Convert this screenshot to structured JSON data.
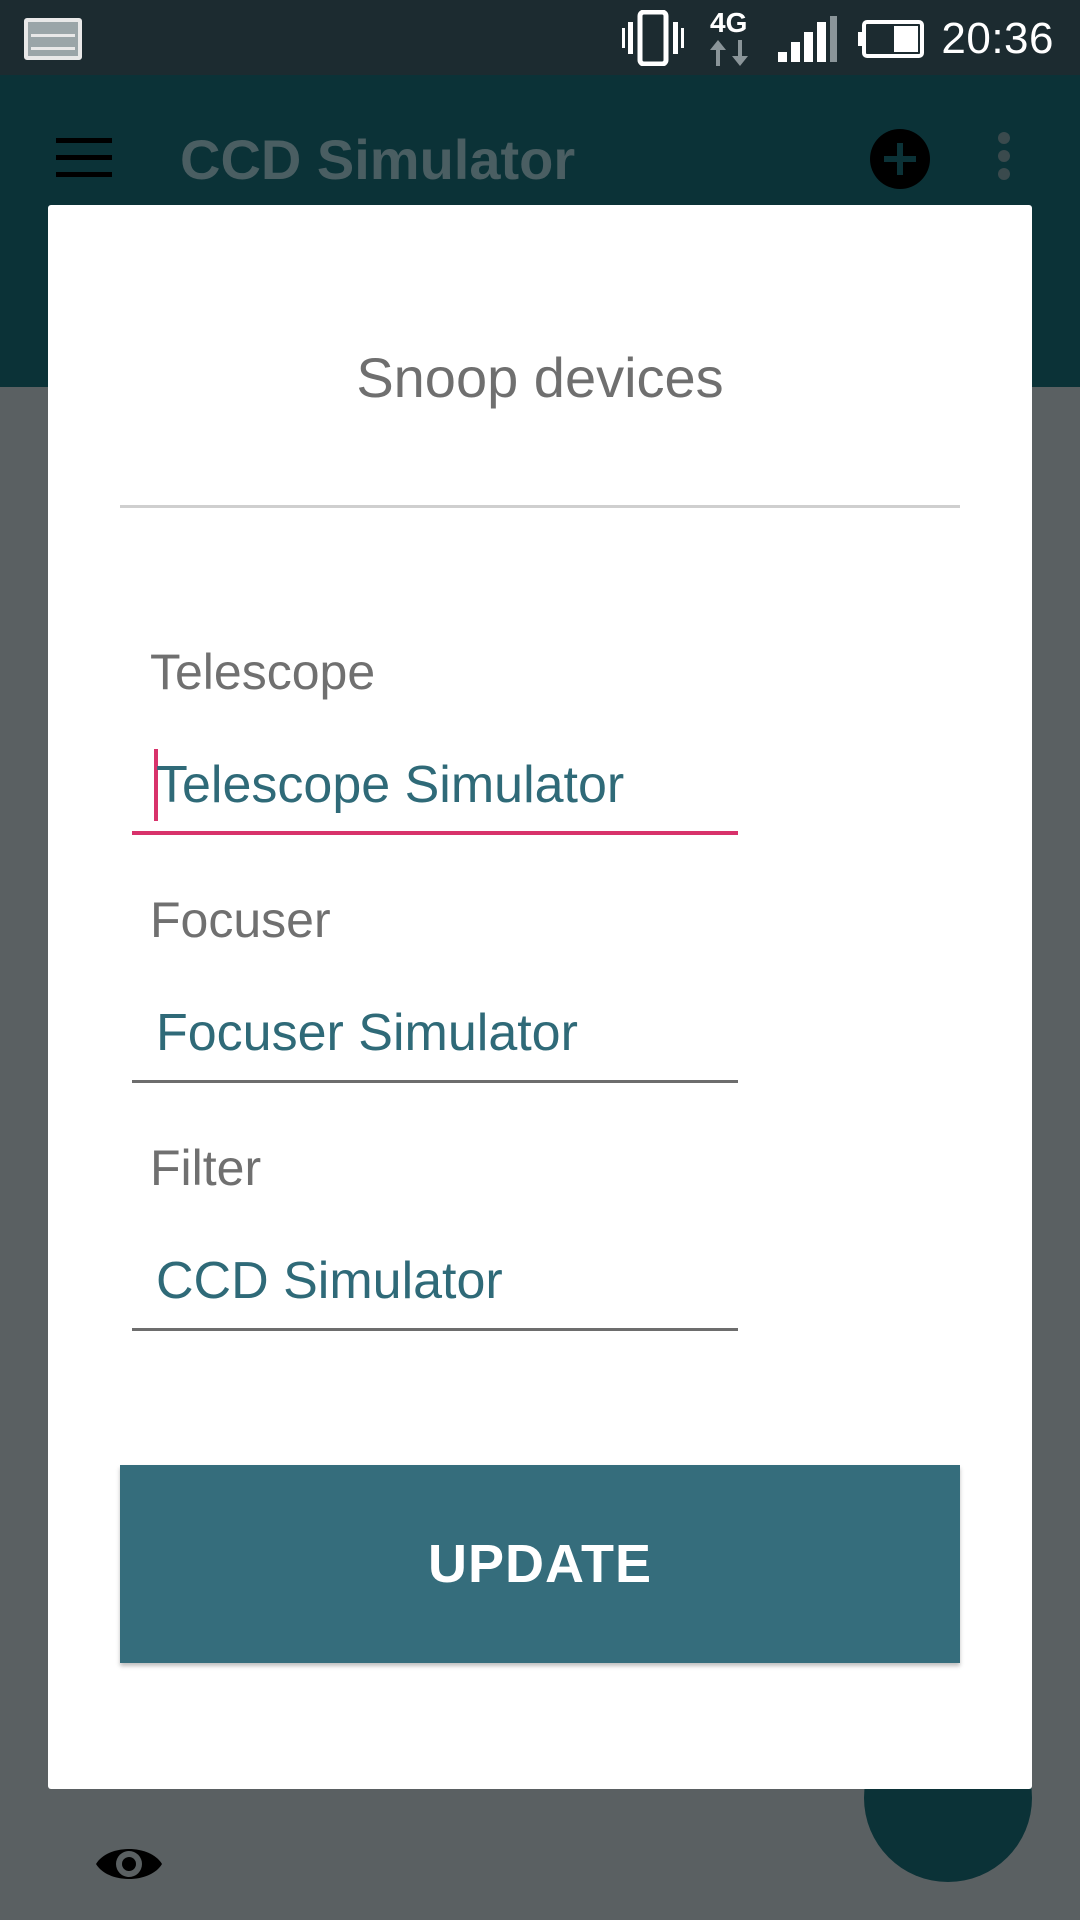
{
  "status_bar": {
    "network_label": "4G",
    "time": "20:36",
    "icons": [
      "screenshot-thumbnail-icon",
      "vibrate-icon",
      "network-4g-icon",
      "signal-icon",
      "battery-icon"
    ]
  },
  "app_bar": {
    "title": "CCD Simulator",
    "icons": [
      "menu-icon",
      "add-circle-icon",
      "more-vert-icon"
    ]
  },
  "dialog": {
    "title": "Snoop devices",
    "fields": [
      {
        "label": "Telescope",
        "value": "Telescope Simulator",
        "focused": true
      },
      {
        "label": "Focuser",
        "value": "Focuser Simulator",
        "focused": false
      },
      {
        "label": "Filter",
        "value": "CCD Simulator",
        "focused": false
      }
    ],
    "update_button_label": "UPDATE"
  },
  "background": {
    "icons": [
      "eye-icon",
      "fab-button"
    ]
  },
  "colors": {
    "app_bar": "#0b3237",
    "status_bar": "#1c2b30",
    "accent": "#d8326b",
    "button": "#356d7c",
    "input_text": "#2f6a78"
  }
}
